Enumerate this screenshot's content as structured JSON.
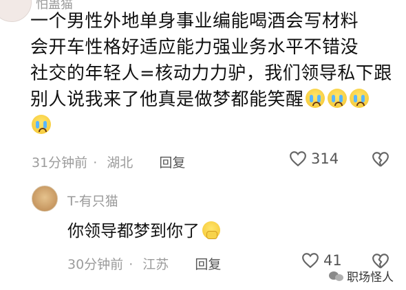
{
  "top_comment": {
    "username_partial": "怕蛊猫",
    "lines": [
      "一个男性外地单身事业编能喝酒会写材料",
      "会开车性格好适应能力强业务水平不错没",
      "社交的年轻人=核动力力驴，我们领导私下跟",
      "别人说我来了他真是做梦都能笑醒"
    ],
    "emoji": "crying-emoji",
    "time": "31分钟前",
    "location": "湖北",
    "reply_label": "回复",
    "likes": "314"
  },
  "reply_comment": {
    "username": "T-有只猫",
    "text": "你领导都梦到你了",
    "emoji": "pleading-emoji",
    "time": "30分钟前",
    "location": "江苏",
    "reply_label": "回复",
    "likes": "41"
  },
  "watermark": {
    "text": "职场怪人"
  },
  "colors": {
    "meta_gray": "#9b9b9b",
    "text_black": "#111111"
  }
}
